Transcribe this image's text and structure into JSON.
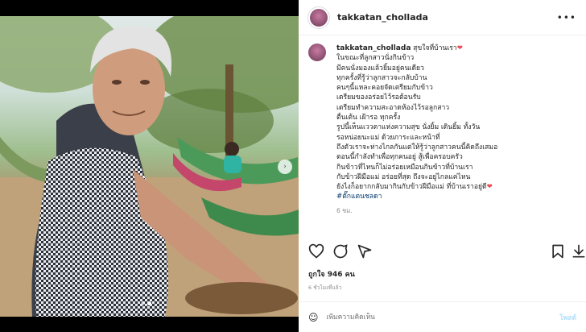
{
  "post": {
    "username": "takkatan_chollada",
    "caption_user": "takkatan_chollada",
    "caption_first": "สุขใจที่บ้านเรา",
    "caption_lines": [
      "ในขณะที่ลูกสาวนั่งกินข้าว",
      "มีคนนั่งมองแล้วยิ้มอยู่คนเดียว",
      "ทุกครั้งที่รู้ว่าลูกสาวจะกลับบ้าน",
      "คนๆนี้แหละคอยจัดเตรียมกับข้าว",
      "เตรียมของอร่อยไว้รอต้อนรับ",
      "เตรียมทำความสะอาดห้องไว้รอลูกสาว",
      "ตื่นเต้น เฝ้ารอ ทุกครั้ง",
      "รูปนี้เห็นแววตาแห่งความสุข นั่งยิ้ม เดินยิ้ม ทั้งวัน",
      "รอหน่อยนะแม่ ด้วยภาระและหน้าที่",
      "ถึงตัวเราจะห่างไกลกันแต่ให้รู้ว่าลูกสาวคนนี้คิดถึงเสมอ",
      "ตอนนี้กำลังทำเพื่อทุกคนอยู่ สู้เพื่อครอบครัว",
      "กินข้าวที่ไหนก็ไม่อร่อยเหมือนกินข้าวที่บ้านเรา",
      "กับข้าวฝีมือแม่ อร่อยที่สุด ถึงจะอยู่ไกลแค่ไหน",
      "ยังไงก็อยากกลับมากินกับข้าวฝีมือแม่ ที่บ้านเราอยู่ดี"
    ],
    "hashtag": "#ตั๊กแตนชลดา",
    "time": "6 ชม.",
    "likes": "ถูกใจ 946 คน",
    "posted_ago": "6 ชั่วโมงที่แล้ว",
    "comment_placeholder": "เพิ่มความคิดเห็น",
    "post_button": "โพสต์"
  },
  "colors": {
    "heart": "#ed4956",
    "link": "#00376b",
    "post_disabled": "#b2dffc"
  },
  "icons": [
    "heart-icon",
    "comment-icon",
    "share-icon",
    "bookmark-icon",
    "download-icon",
    "emoji-icon",
    "more-icon",
    "next-arrow-icon"
  ]
}
